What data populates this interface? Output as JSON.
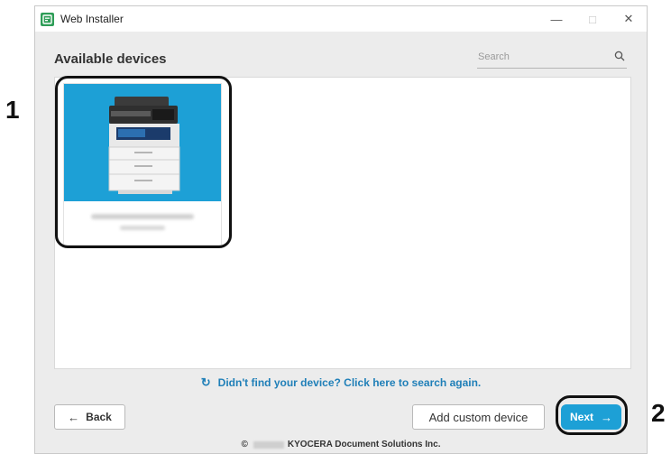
{
  "callouts": {
    "one": "1",
    "two": "2"
  },
  "window": {
    "title": "Web Installer",
    "controls": {
      "minimize": "—",
      "maximize": "□",
      "close": "✕"
    }
  },
  "main": {
    "heading": "Available devices",
    "search": {
      "placeholder": "Search"
    },
    "devices": [
      {
        "icon": "printer-image",
        "selected": true
      }
    ],
    "search_again_icon": "↻",
    "search_again_text": "Didn't find your device? Click here to search again."
  },
  "buttons": {
    "back_arrow": "←",
    "back": "Back",
    "add_custom": "Add custom device",
    "next": "Next",
    "next_arrow": "→"
  },
  "footer": {
    "copyright": "©",
    "text": "KYOCERA Document Solutions Inc."
  },
  "colors": {
    "accent": "#1da0d6",
    "link": "#1f7fb8",
    "app_icon": "#2e9d57"
  }
}
